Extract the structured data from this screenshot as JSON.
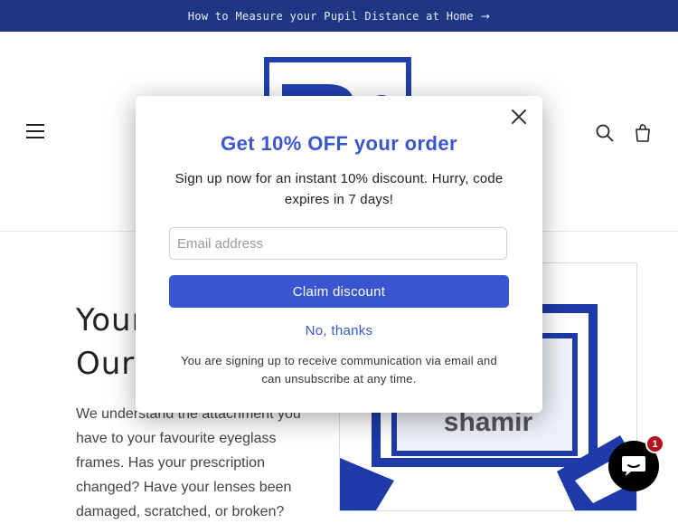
{
  "announcement": {
    "text": "How to Measure your Pupil Distance at Home",
    "arrow": "→"
  },
  "header": {
    "menu_icon": "hamburger-menu-icon",
    "search_icon": "search-icon",
    "cart_icon": "cart-icon",
    "logo_letters": "Rx"
  },
  "hero": {
    "title_line1": "Your",
    "title_line2": "Our",
    "title": "Your\nOur",
    "paragraph": "We understand the attachment you have to your favourite eyeglass frames. Has your prescription changed? Have your lenses been damaged, scratched, or broken?",
    "image_brand": "shamir"
  },
  "popup": {
    "title": "Get 10% OFF your order",
    "subtitle": "Sign up now for an instant 10% discount. Hurry, code expires in 7 days!",
    "email_placeholder": "Email address",
    "email_value": "",
    "claim_label": "Claim discount",
    "decline_label": "No, thanks",
    "legal": "You are signing up to receive communication via email and can unsubscribe at any time.",
    "close_icon": "close-icon"
  },
  "chat": {
    "badge_count": "1",
    "icon": "chat-bubble-icon"
  },
  "colors": {
    "announcement_bg": "#1f3685",
    "accent": "#3a55d0",
    "badge": "#b71220"
  }
}
